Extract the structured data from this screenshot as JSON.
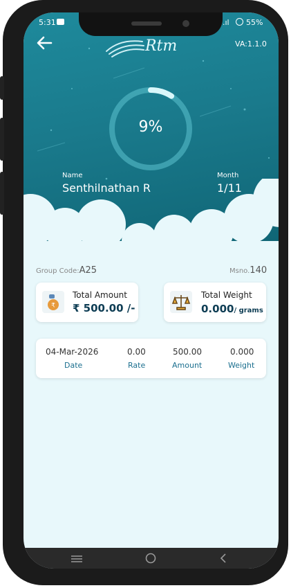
{
  "status_bar": {
    "time": "5:31",
    "signal": ".ıl",
    "battery": "55%"
  },
  "header": {
    "logo": "Rtm",
    "version": "VA:1.1.0"
  },
  "progress": {
    "percent_label": "9%",
    "value": 0.09
  },
  "member": {
    "name_label": "Name",
    "name": "Senthilnathan R",
    "month_label": "Month",
    "month": "1/11"
  },
  "group": {
    "code_label": "Group Code:",
    "code": "A25",
    "msno_label": "Msno.",
    "msno": "140"
  },
  "summary": {
    "amount_title": "Total Amount",
    "amount_value": "₹ 500.00 /-",
    "weight_title": "Total Weight",
    "weight_value": "0.000",
    "weight_unit": "/ grams"
  },
  "transactions": {
    "columns": [
      "Date",
      "Rate",
      "Amount",
      "Weight"
    ],
    "rows": [
      [
        "04-Mar-2026",
        "0.00",
        "500.00",
        "0.000"
      ]
    ]
  },
  "colors": {
    "teal": "#1a7a8c",
    "label": "#1a6e8e",
    "bg": "#e8f8fb"
  }
}
